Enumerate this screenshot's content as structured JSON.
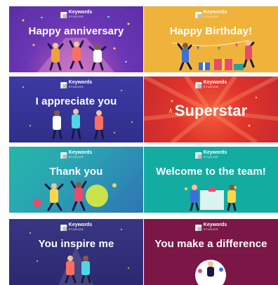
{
  "brand": {
    "name": "Keywords",
    "sub": "STUDIOS"
  },
  "cards": [
    {
      "title": "Happy anniversary",
      "bg": "#6a36b4"
    },
    {
      "title": "Happy Birthday!",
      "bg": "#efb33c"
    },
    {
      "title": "I appreciate you",
      "bg": "#3d3aa4"
    },
    {
      "title": "Superstar",
      "bg": "#e0342c"
    },
    {
      "title": "Thank you",
      "bg": "#2aa5b3"
    },
    {
      "title": "Welcome to the team!",
      "bg": "#13aca0"
    },
    {
      "title": "You inspire me",
      "bg": "#2f2c78"
    },
    {
      "title": "You make a difference",
      "bg": "#7a1747"
    }
  ]
}
